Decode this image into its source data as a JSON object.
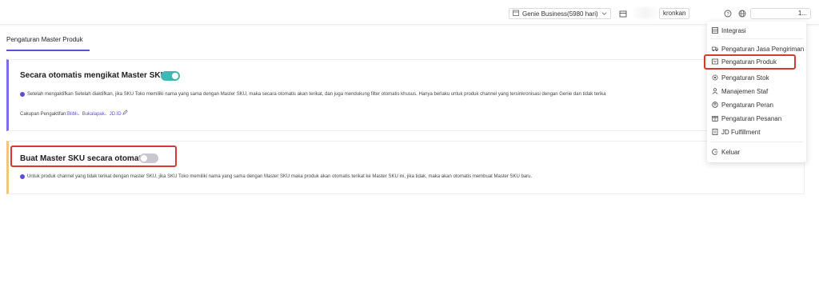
{
  "header": {
    "plan_label": "Genie Business(5980 hari)",
    "sync_label": "kronkan",
    "user_label": "1..."
  },
  "tabs": [
    {
      "label": "Pengaturan Master Produk"
    }
  ],
  "card1": {
    "title": "Secara otomatis mengikat Master SKU",
    "toggle_on": true,
    "description": "Setelah mengaktifkan Setelah diaktifkan, jika SKU Toko memiliki nama yang sama dengan Master SKU, maka secara otomatis akan terikat, dan juga mendukung filter otomatis khusus. Hanya berlaku untuk produk channel yang tersinkronisasi dengan Genie dan tidak terika",
    "scope_label": "Cakupan Pengaktifan:",
    "scope_links": "Blibli、Bukalapak、JD.ID"
  },
  "card2": {
    "title": "Buat Master SKU secara otomatis",
    "toggle_on": false,
    "description": "Untuk produk channel yang tidak terikat dengan master SKU, jika SKU Toko memiliki nama yang sama dengan Master SKU maka produk akan otomatis terikat ke Master SKU ini, jika tidak, maka akan otomatis membuat Master SKU baru."
  },
  "menu": {
    "items": [
      {
        "label": "Integrasi",
        "icon": "integration-icon"
      },
      {
        "label": "Pengaturan Jasa Pengiriman",
        "icon": "truck-icon"
      },
      {
        "label": "Pengaturan Produk",
        "icon": "product-icon"
      },
      {
        "label": "Pengaturan Stok",
        "icon": "stock-gear-icon"
      },
      {
        "label": "Manajemen Staf",
        "icon": "staff-icon"
      },
      {
        "label": "Pengaturan Peran",
        "icon": "role-icon"
      },
      {
        "label": "Pengaturan Pesanan",
        "icon": "order-icon"
      },
      {
        "label": "JD Fulfillment",
        "icon": "fulfillment-icon"
      },
      {
        "label": "Keluar",
        "icon": "logout-icon"
      }
    ]
  },
  "colors": {
    "accent": "#5b4fd6",
    "toggle_on": "#3fb7b4",
    "highlight": "#d63a2f",
    "card2_border": "#f3c57a"
  }
}
